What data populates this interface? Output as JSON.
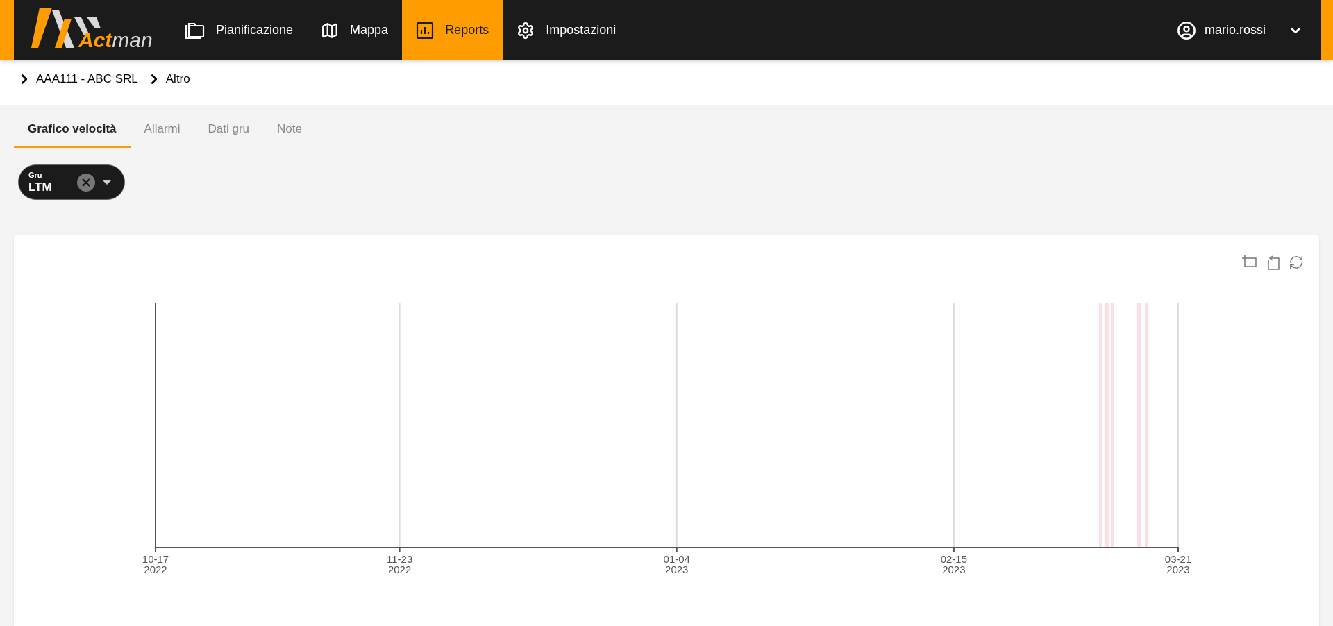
{
  "logo": {
    "bold": "Act",
    "light": "man"
  },
  "nav": [
    {
      "kind": "folders",
      "label": "Pianificazione",
      "selected": false
    },
    {
      "kind": "map",
      "label": "Mappa",
      "selected": false
    },
    {
      "kind": "chart",
      "label": "Reports",
      "selected": true
    },
    {
      "kind": "gear",
      "label": "Impostazioni",
      "selected": false
    }
  ],
  "user": {
    "name": "mario.rossi"
  },
  "breadcrumb": [
    "AAA111 - ABC SRL",
    "Altro"
  ],
  "tabs": [
    {
      "label": "Grafico velocità",
      "selected": true
    },
    {
      "label": "Allarmi",
      "selected": false
    },
    {
      "label": "Dati gru",
      "selected": false
    },
    {
      "label": "Note",
      "selected": false
    }
  ],
  "filter": {
    "label": "Gru",
    "value": "LTM"
  },
  "chart": {
    "xticks": [
      {
        "date": "10-17",
        "year": "2022"
      },
      {
        "date": "11-23",
        "year": "2022"
      },
      {
        "date": "01-04",
        "year": "2023"
      },
      {
        "date": "02-15",
        "year": "2023"
      },
      {
        "date": "03-21",
        "year": "2023"
      }
    ]
  }
}
